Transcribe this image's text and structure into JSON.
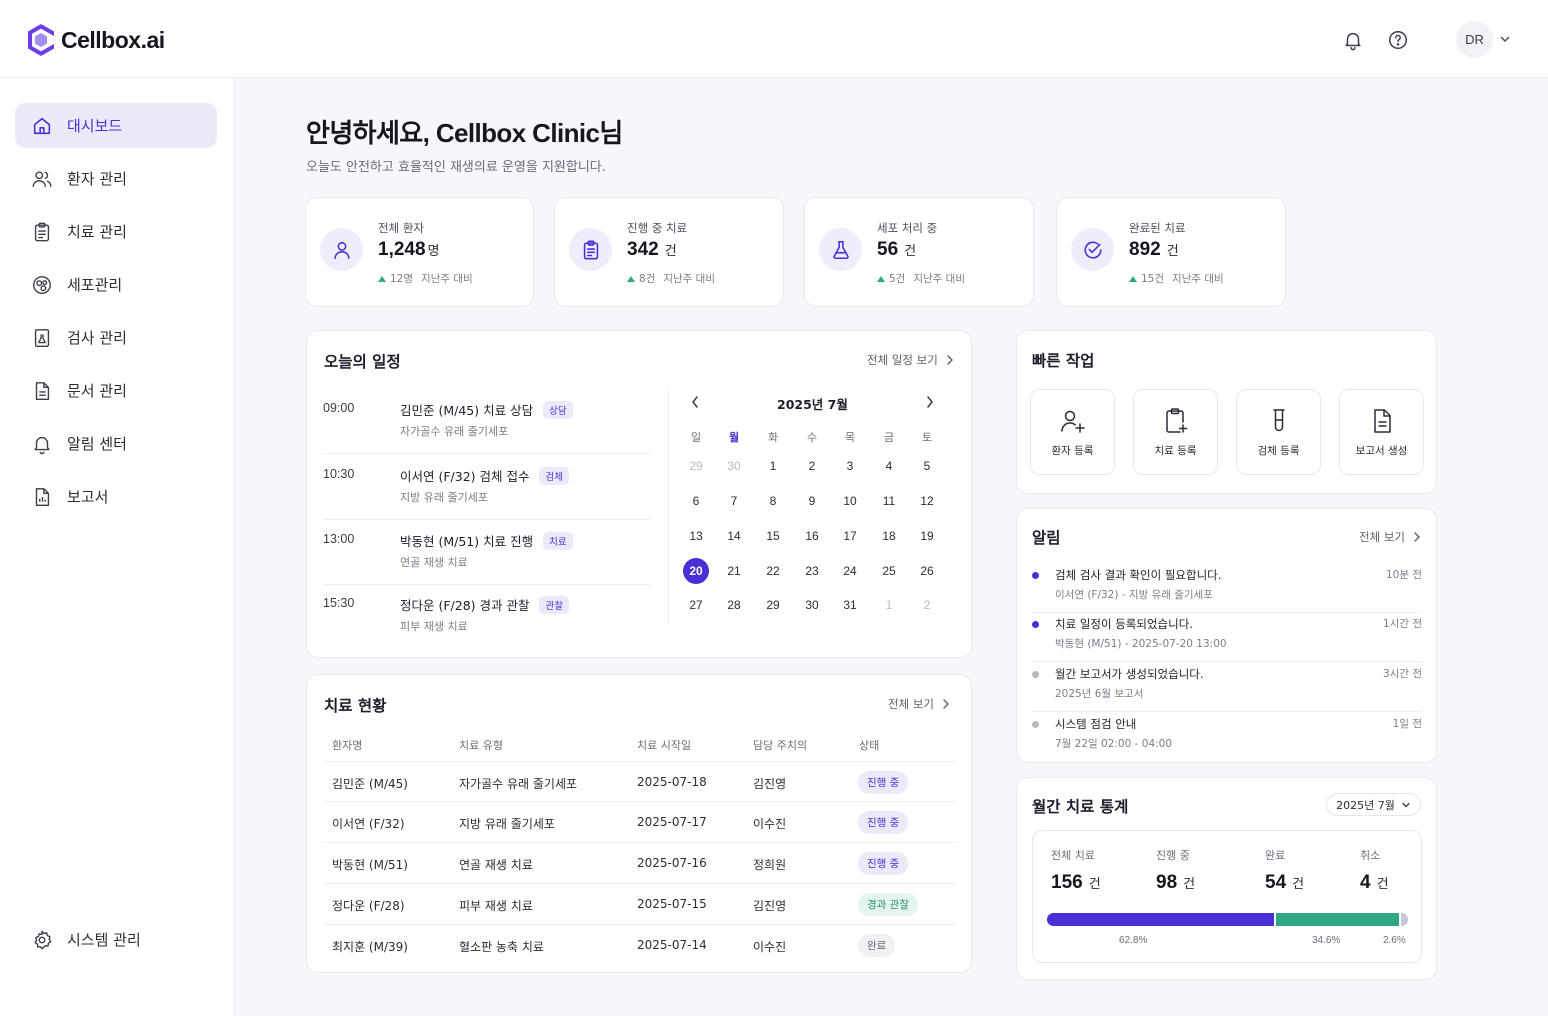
{
  "brand": {
    "name": "Cellbox.ai",
    "accent": "#4b2fd6"
  },
  "header": {
    "avatar_initials": "DR",
    "icons": [
      "bell-icon",
      "help-icon",
      "chevron-down-icon"
    ]
  },
  "sidebar": {
    "items": [
      {
        "label": "대시보드",
        "icon": "home-icon",
        "active": true
      },
      {
        "label": "환자 관리",
        "icon": "users-icon"
      },
      {
        "label": "치료 관리",
        "icon": "clipboard-icon"
      },
      {
        "label": "세포관리",
        "icon": "cells-icon"
      },
      {
        "label": "검사 관리",
        "icon": "lab-report-icon"
      },
      {
        "label": "문서 관리",
        "icon": "document-icon"
      },
      {
        "label": "알림 센터",
        "icon": "bell-icon"
      },
      {
        "label": "보고서",
        "icon": "report-icon"
      }
    ],
    "footer_label": "시스템 관리"
  },
  "greeting": {
    "title": "안녕하세요, Cellbox Clinic님",
    "subtitle": "오늘도 안전하고 효율적인 재생의료 운영을 지원합니다."
  },
  "stats": [
    {
      "label": "전체 환자",
      "value": "1,248",
      "unit": "명",
      "delta": "12명",
      "delta_suffix": "지난주 대비"
    },
    {
      "label": "진행 중 치료",
      "value": "342",
      "unit": "건",
      "delta": "8건",
      "delta_suffix": "지난주 대비"
    },
    {
      "label": "세포 처리 중",
      "value": "56",
      "unit": "건",
      "delta": "5건",
      "delta_suffix": "지난주 대비"
    },
    {
      "label": "완료된 치료",
      "value": "892",
      "unit": "건",
      "delta": "15건",
      "delta_suffix": "지난주 대비"
    }
  ],
  "schedule": {
    "title": "오늘의 일정",
    "link": "전체 일정 보기",
    "items": [
      {
        "time": "09:00",
        "title": "김민준 (M/45) 치료 상담",
        "tag": "상담",
        "desc": "자가골수 유래 줄기세포"
      },
      {
        "time": "10:30",
        "title": "이서연 (F/32) 검체 접수",
        "tag": "검체",
        "desc": "지방 유래 줄기세포"
      },
      {
        "time": "13:00",
        "title": "박동현 (M/51) 치료 진행",
        "tag": "치료",
        "desc": "연골 재생 치료"
      },
      {
        "time": "15:30",
        "title": "정다운 (F/28)  경과 관찰",
        "tag": "관찰",
        "desc": "피부 재생 치료"
      }
    ]
  },
  "calendar": {
    "month_label": "2025년 7월",
    "weekdays": [
      "일",
      "월",
      "화",
      "수",
      "목",
      "금",
      "토"
    ],
    "selected_weekday_index": 1,
    "weeks": [
      [
        "29",
        "30",
        "1",
        "2",
        "3",
        "4",
        "5"
      ],
      [
        "6",
        "7",
        "8",
        "9",
        "10",
        "11",
        "12"
      ],
      [
        "13",
        "14",
        "15",
        "16",
        "17",
        "18",
        "19"
      ],
      [
        "20",
        "21",
        "22",
        "23",
        "24",
        "25",
        "26"
      ],
      [
        "27",
        "28",
        "29",
        "30",
        "31",
        "1",
        "2"
      ]
    ],
    "today": "20"
  },
  "quick_actions": {
    "title": "빠른 작업",
    "items": [
      {
        "label": "환자 등록",
        "icon": "user-add-icon"
      },
      {
        "label": "치료 등록",
        "icon": "clipboard-add-icon"
      },
      {
        "label": "검체 등록",
        "icon": "test-tube-icon"
      },
      {
        "label": "보고서 생성",
        "icon": "document-icon"
      }
    ]
  },
  "alerts": {
    "title": "알림",
    "link": "전체 보기",
    "items": [
      {
        "title": "검체 검사 결과 확인이 필요합니다.",
        "sub": "이서연 (F/32) - 지방 유래 줄기세포",
        "time": "10분 전",
        "unread": true
      },
      {
        "title": "치료 일정이 등록되었습니다.",
        "sub": "박동현 (M/51) - 2025-07-20 13:00",
        "time": "1시간 전",
        "unread": true
      },
      {
        "title": "월간 보고서가 생성되었습니다.",
        "sub": "2025년 6월 보고서",
        "time": "3시간 전",
        "unread": false
      },
      {
        "title": "시스템 점검 안내",
        "sub": "7월 22일 02:00 - 04:00",
        "time": "1일 전",
        "unread": false
      }
    ]
  },
  "treatments": {
    "title": "치료 현황",
    "link": "전체 보기",
    "columns": [
      "환자명",
      "치료 유형",
      "치료 시작일",
      "담당 주치의",
      "상태"
    ],
    "rows": [
      {
        "patient": "김민준 (M/45)",
        "type": "자가골수 유래 줄기세포",
        "start": "2025-07-18",
        "doctor": "김진영",
        "status": "진행 중",
        "status_kind": "progress"
      },
      {
        "patient": "이서연 (F/32)",
        "type": "지방 유래 줄기세포",
        "start": "2025-07-17",
        "doctor": "이수진",
        "status": "진행 중",
        "status_kind": "progress"
      },
      {
        "patient": "박동현 (M/51)",
        "type": "연골 재생 치료",
        "start": "2025-07-16",
        "doctor": "정희원",
        "status": "진행 중",
        "status_kind": "progress"
      },
      {
        "patient": "정다운 (F/28)",
        "type": "피부 재생 치료",
        "start": "2025-07-15",
        "doctor": "김진영",
        "status": "경과 관찰",
        "status_kind": "observe"
      },
      {
        "patient": "최지훈 (M/39)",
        "type": "혈소판 농축 치료",
        "start": "2025-07-14",
        "doctor": "이수진",
        "status": "완료",
        "status_kind": "done"
      }
    ]
  },
  "monthly": {
    "title": "월간 치료 통계",
    "month": "2025년 7월",
    "metrics": [
      {
        "label": "전체 치료",
        "value": "156",
        "unit": "건"
      },
      {
        "label": "진행 중",
        "value": "98",
        "unit": "건"
      },
      {
        "label": "완료",
        "value": "54",
        "unit": "건"
      },
      {
        "label": "취소",
        "value": "4",
        "unit": "건"
      }
    ],
    "segments": [
      {
        "label": "62.8%",
        "percent": 62.8,
        "color": "#4b2fd6"
      },
      {
        "label": "34.6%",
        "percent": 34.6,
        "color": "#2fa785"
      },
      {
        "label": "2.6%",
        "percent": 2.6,
        "color": "#c3c8d6"
      }
    ]
  }
}
